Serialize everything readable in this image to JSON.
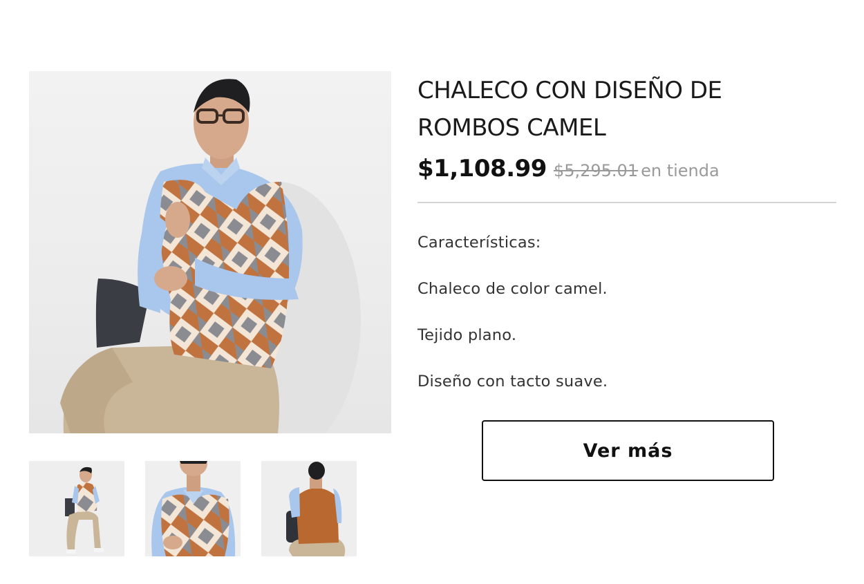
{
  "product": {
    "title": "CHALECO CON DISEÑO DE ROMBOS CAMEL",
    "price": "$1,108.99",
    "old_price": "$5,295.01",
    "price_note": "en tienda",
    "features": [
      "Características:",
      "Chaleco de color camel.",
      "Tejido plano.",
      "Diseño con tacto suave."
    ],
    "cta_label": "Ver más"
  },
  "gallery": {
    "main_image_icon": "model-photo-seated-front",
    "thumbnails": [
      {
        "icon": "model-photo-full-body"
      },
      {
        "icon": "model-photo-closeup"
      },
      {
        "icon": "model-photo-back"
      }
    ]
  },
  "colors": {
    "camel": "#c0733e",
    "grey_diamond": "#8a8c92",
    "cream_diamond": "#f3e6d6",
    "shirt_blue": "#a9c6ec",
    "pants_khaki": "#c9b597"
  }
}
